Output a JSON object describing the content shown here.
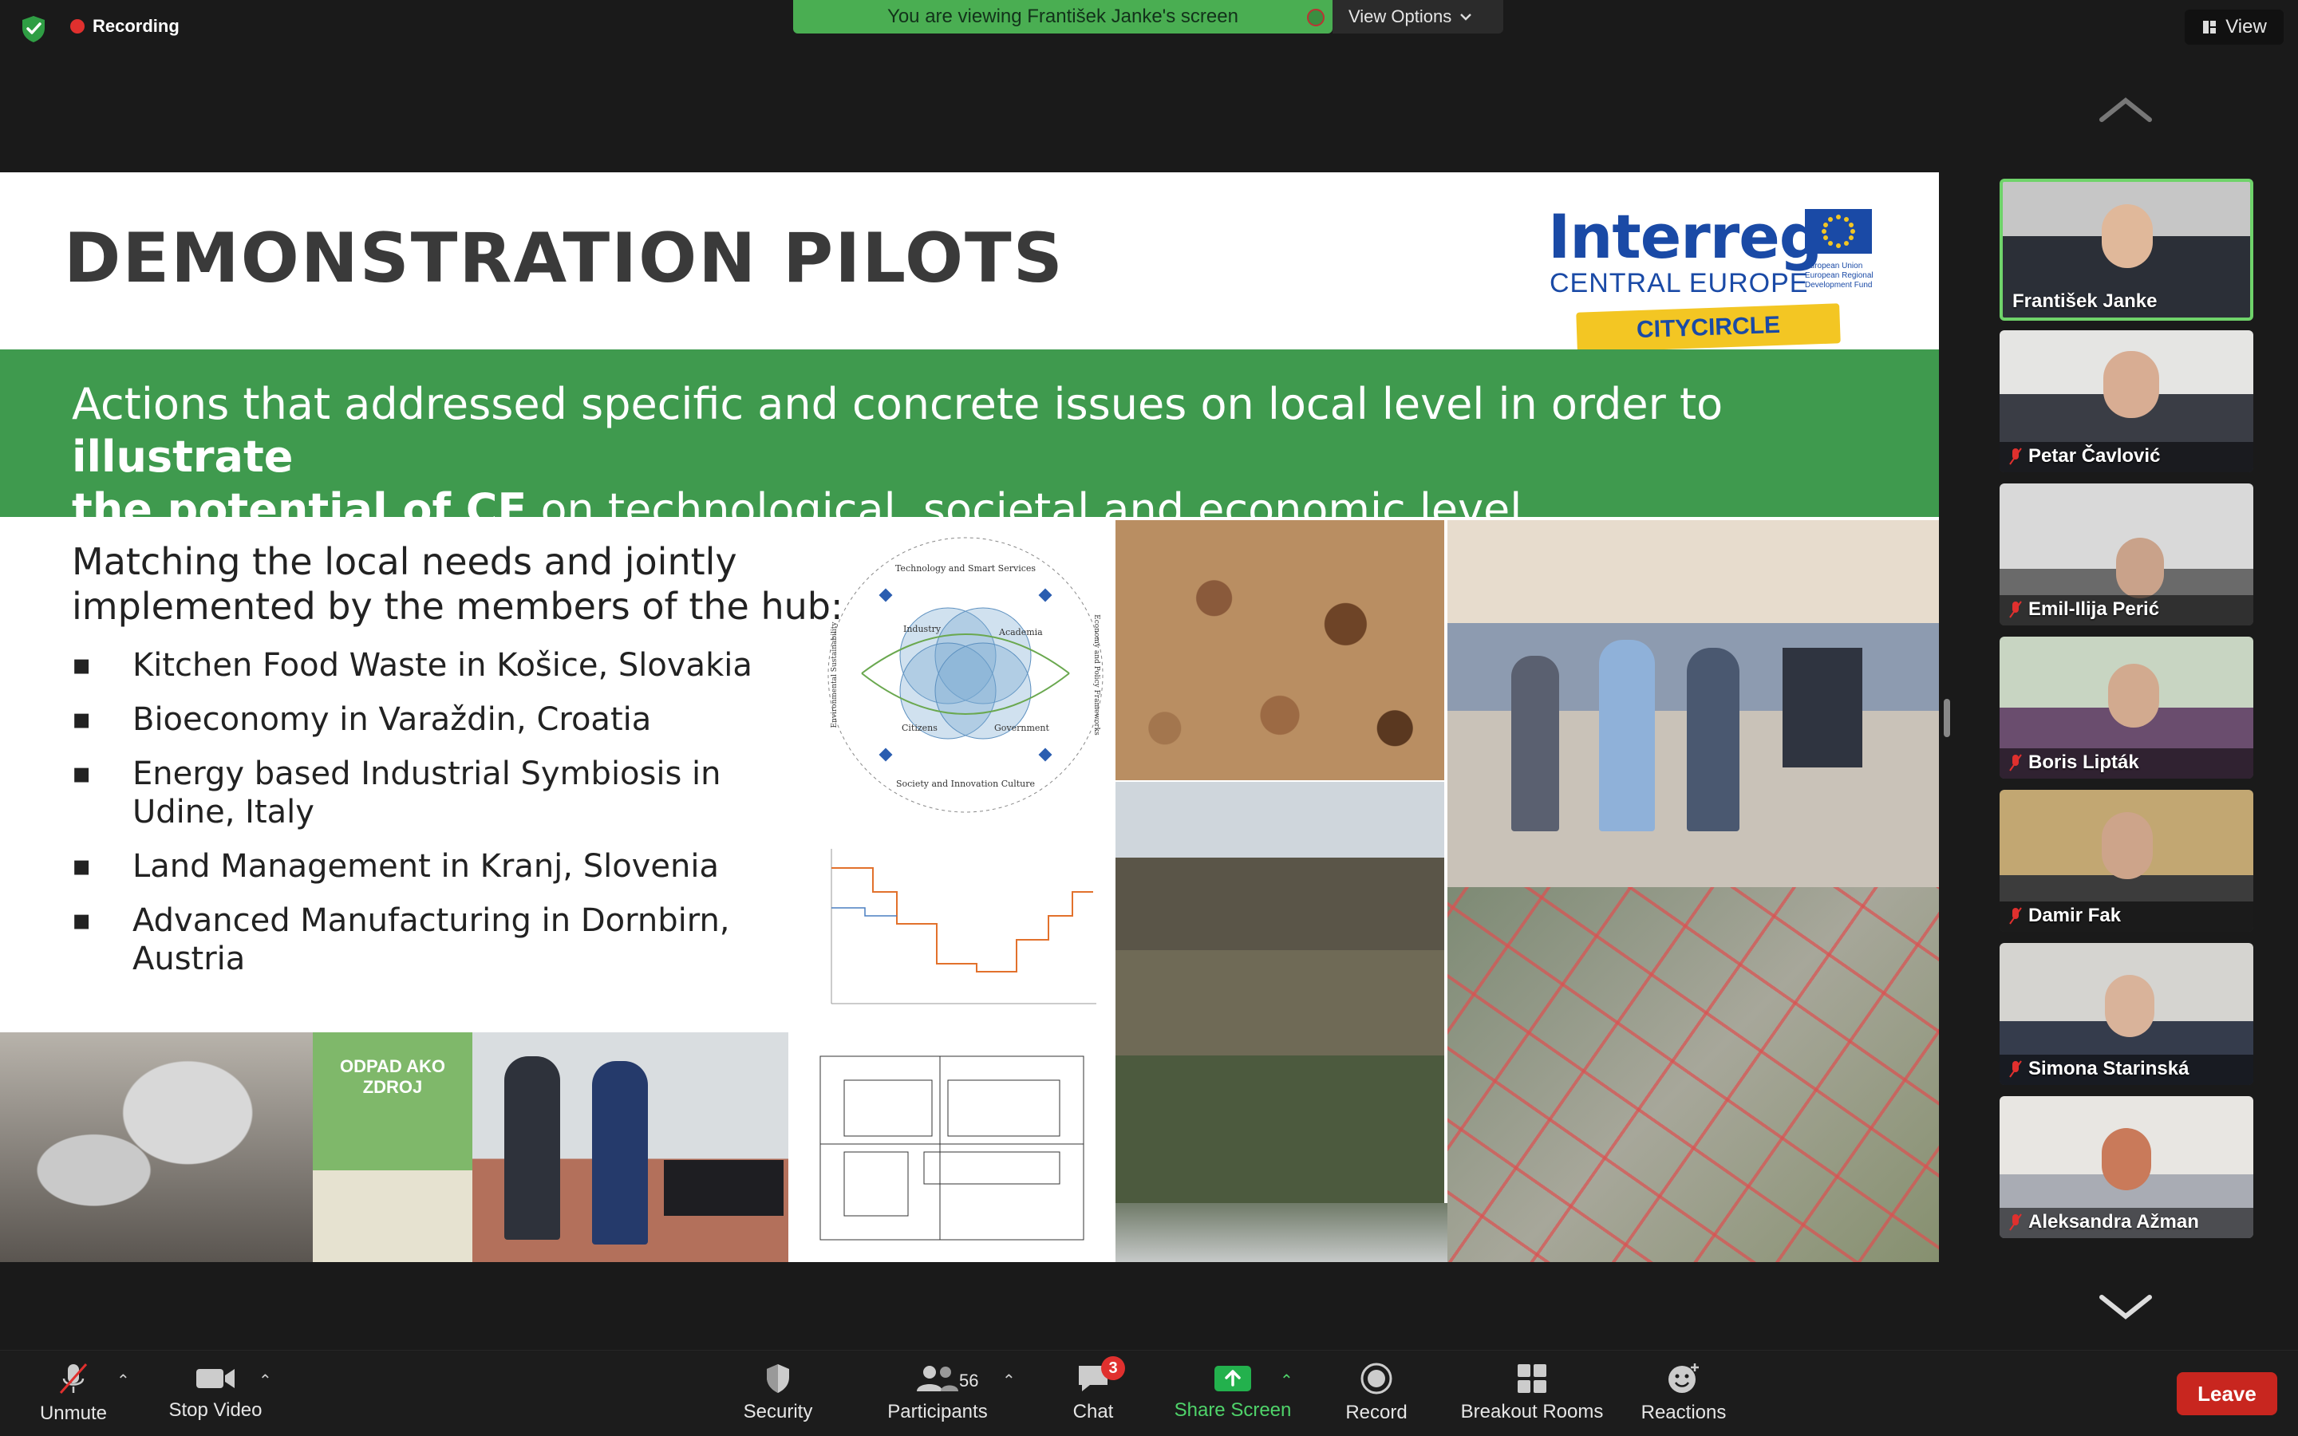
{
  "top_bar": {
    "recording_label": "Recording",
    "banner_text": "You are viewing František Janke's screen",
    "view_options_label": "View Options",
    "view_label": "View"
  },
  "slide": {
    "title": "DEMONSTRATION PILOTS",
    "logo": {
      "brand": "Interreg",
      "program": "CENTRAL EUROPE",
      "eu_text": "European Union European Regional Development Fund",
      "project": "CITYCIRCLE"
    },
    "band": {
      "line1_plain": "Actions that addressed specific and concrete issues on local level in order to ",
      "line1_bold": "illustrate",
      "line2_bold": "the potential of CE",
      "line2_plain": " on technological, societal and economic level"
    },
    "lead_line1": "Matching the local needs and jointly",
    "lead_line2": "implemented by the members of the hub:",
    "bullets": [
      "Kitchen Food Waste in Košice, Slovakia",
      "Bioeconomy in Varaždin, Croatia",
      "Energy based Industrial Symbiosis in Udine, Italy",
      "Land Management in Kranj, Slovenia",
      "Advanced Manufacturing in Dornbirn, Austria"
    ],
    "diagram": {
      "top": "Technology and Smart Services",
      "left": "Industry",
      "right": "Academia",
      "bottom_left": "Citizens",
      "bottom_right": "Government",
      "bottom": "Society and Innovation Culture",
      "side_left": "Environmental Sustainability",
      "side_right": "Economy and Policy Frameworks"
    },
    "poster_title": "ODPAD AKO ZDROJ"
  },
  "participants": [
    {
      "name": "František Janke",
      "muted": false,
      "active": true
    },
    {
      "name": "Petar Čavlović",
      "muted": true,
      "active": false
    },
    {
      "name": "Emil-Ilija Perić",
      "muted": true,
      "active": false
    },
    {
      "name": "Boris Lipták",
      "muted": true,
      "active": false
    },
    {
      "name": "Damir Fak",
      "muted": true,
      "active": false
    },
    {
      "name": "Simona Starinská",
      "muted": true,
      "active": false
    },
    {
      "name": "Aleksandra Ažman",
      "muted": true,
      "active": false
    }
  ],
  "toolbar": {
    "unmute": "Unmute",
    "stop_video": "Stop Video",
    "security": "Security",
    "participants": "Participants",
    "participants_count": "56",
    "chat": "Chat",
    "chat_badge": "3",
    "share_screen": "Share Screen",
    "record": "Record",
    "breakout_rooms": "Breakout Rooms",
    "reactions": "Reactions",
    "leave": "Leave"
  },
  "colors": {
    "band_green": "#3f9a4e",
    "banner_green": "#4aae52",
    "active_border": "#6fd36a",
    "leave_red": "#c8261f",
    "share_green": "#23b14d"
  }
}
